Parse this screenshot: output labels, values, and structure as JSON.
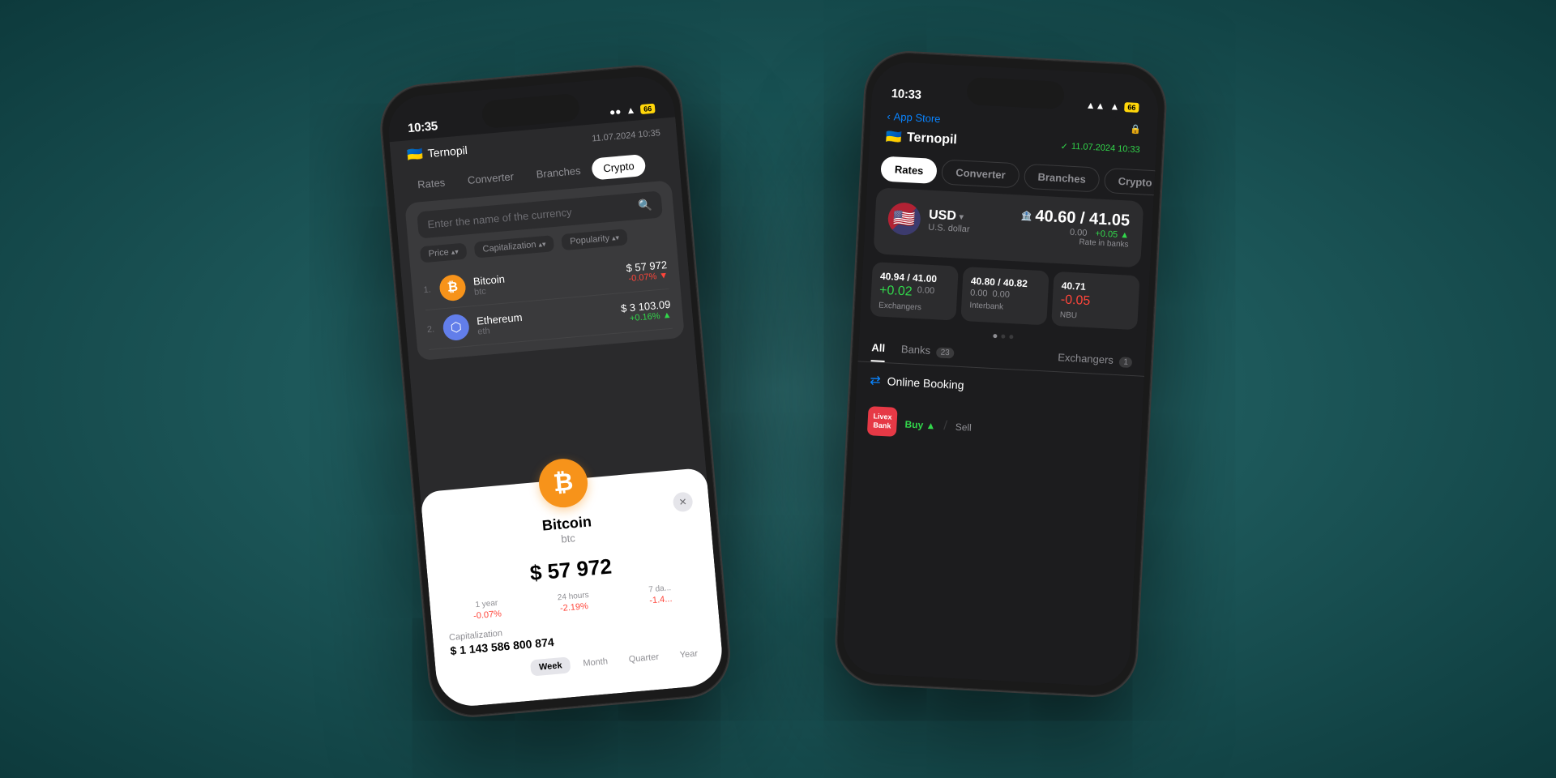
{
  "background": {
    "color": "#2a6b6e"
  },
  "left_phone": {
    "status_bar": {
      "time": "10:35",
      "battery": "66"
    },
    "header": {
      "city": "Ternopil",
      "date": "11.07.2024  10:35"
    },
    "tabs": [
      {
        "label": "Rates",
        "active": false
      },
      {
        "label": "Converter",
        "active": false
      },
      {
        "label": "Branches",
        "active": false
      },
      {
        "label": "Crypto",
        "active": true
      }
    ],
    "search": {
      "placeholder": "Enter the name of the currency"
    },
    "sort_buttons": [
      {
        "label": "Price"
      },
      {
        "label": "Capitalization"
      },
      {
        "label": "Popularity"
      }
    ],
    "crypto_list": [
      {
        "rank": "1.",
        "name": "Bitcoin",
        "symbol": "btc",
        "price": "$ 57 972",
        "change": "-0.07%",
        "change_type": "neg"
      },
      {
        "rank": "2.",
        "name": "Ethereum",
        "symbol": "eth",
        "price": "$ 3 103.09",
        "change": "+0.16%",
        "change_type": "pos"
      }
    ],
    "btc_detail": {
      "name": "Bitcoin",
      "symbol": "btc",
      "price": "$ 57 972",
      "stats": [
        {
          "label": "1 year",
          "value": "-0.07%",
          "type": "neg"
        },
        {
          "label": "24 hours",
          "value": "-2.19%",
          "type": "neg"
        },
        {
          "label": "7 da...",
          "value": "-1.4...",
          "type": "neg"
        }
      ],
      "cap_label": "Capitalization",
      "cap_value": "$ 1 143 586 800 874",
      "periods": [
        "Week",
        "Month",
        "Quarter",
        "Year"
      ],
      "active_period": "Week"
    }
  },
  "right_phone": {
    "status_bar": {
      "time": "10:33",
      "battery": "66"
    },
    "back_label": "App Store",
    "header": {
      "city": "Ternopil",
      "date": "11.07.2024 10:33"
    },
    "tabs": [
      {
        "label": "Rates",
        "active": true
      },
      {
        "label": "Converter",
        "active": false
      },
      {
        "label": "Branches",
        "active": false
      },
      {
        "label": "Crypto",
        "active": false
      }
    ],
    "usd_card": {
      "currency": "USD",
      "currency_full": "U.S. dollar",
      "rate": "40.60 / 41.05",
      "change_left": "0.00",
      "change_right": "+0.05",
      "change_right_type": "pos",
      "rate_in_banks": "Rate in banks"
    },
    "sub_rates": [
      {
        "label": "Exchangers",
        "rate": "40.94 / 41.00",
        "change1": "+0.02",
        "change1_type": "pos",
        "change2": "0.00"
      },
      {
        "label": "Interbank",
        "rate": "40.80 / 40.82",
        "change1": "0.00",
        "change2": "0.00"
      },
      {
        "label": "NBU",
        "rate": "40.71",
        "change1": "-0.05",
        "change1_type": "neg"
      }
    ],
    "banks_tabs": [
      {
        "label": "All",
        "active": true
      },
      {
        "label": "Banks",
        "count": "23",
        "active": false
      },
      {
        "label": "Exchangers",
        "count": "1",
        "active": false
      }
    ],
    "online_booking": "Online Booking",
    "bank_row": {
      "name": "Livex Bank",
      "buy_label": "Buy",
      "sell_label": "Sell"
    }
  }
}
